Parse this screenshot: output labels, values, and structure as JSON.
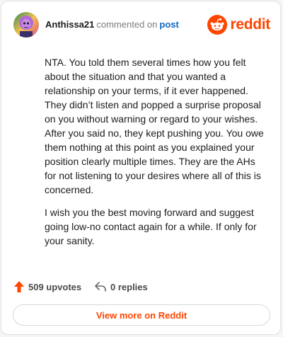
{
  "comment": {
    "username": "Anthissa21",
    "action_text": "commented on",
    "post_link_label": "post",
    "paragraphs": [
      "NTA. You told them several times how you felt about the situation and that you wanted a relationship on your terms, if it ever happened. They didn’t listen and popped a surprise proposal on you without warning or regard to your wishes. After you said no, they kept pushing you. You owe them nothing at this point as you explained your position clearly multiple times. They are the AHs for not listening to your desires where all of this is concerned.",
      "I wish you the best moving forward and suggest going low-no contact again for a while. If only for your sanity."
    ],
    "upvotes_label": "509 upvotes",
    "replies_label": "0 replies"
  },
  "brand": {
    "wordmark": "reddit",
    "color": "#ff4500"
  },
  "cta": {
    "view_more_label": "View more on Reddit"
  },
  "icons": {
    "avatar": "avatar",
    "logo": "reddit-snoo-icon",
    "upvote": "upvote-arrow-icon",
    "reply": "reply-arrow-icon"
  }
}
